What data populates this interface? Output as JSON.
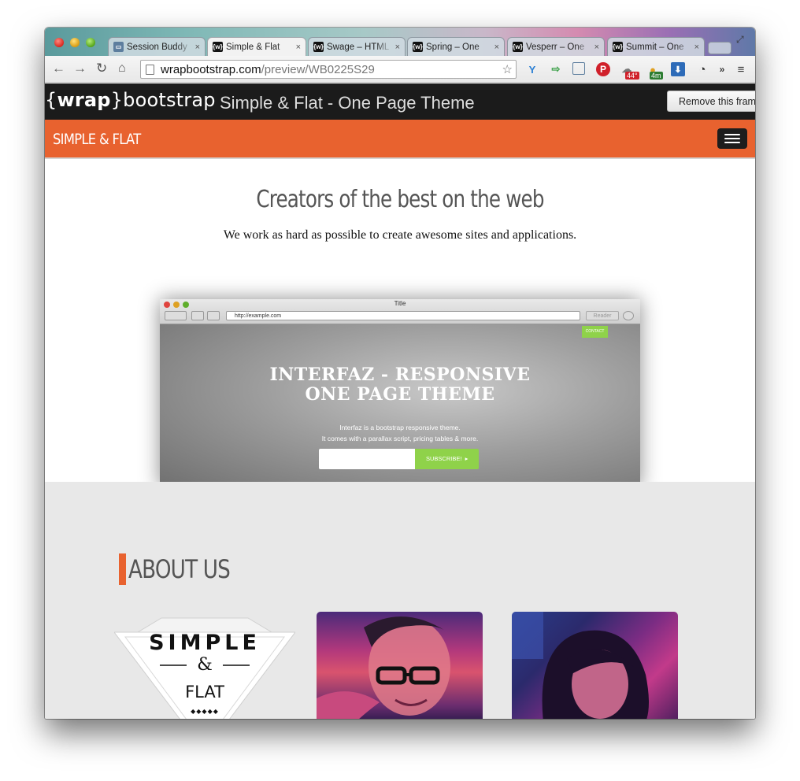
{
  "browser": {
    "tabs": [
      {
        "label": "Session Buddy",
        "icon": "session-buddy-icon",
        "active": false
      },
      {
        "label": "Simple & Flat",
        "icon": "wrap-icon",
        "active": true
      },
      {
        "label": "Swage – HTML",
        "icon": "wrap-icon",
        "active": false
      },
      {
        "label": "Spring – One",
        "icon": "wrap-icon",
        "active": false
      },
      {
        "label": "Vesperr – One",
        "icon": "wrap-icon",
        "active": false
      },
      {
        "label": "Summit – One",
        "icon": "wrap-icon",
        "active": false
      }
    ],
    "tab_close": "×",
    "favicon_text": "{w}",
    "url_host": "wrapbootstrap.com",
    "url_path": "/preview/WB0225S29",
    "badges": {
      "weather": "44°",
      "timer": "4m"
    }
  },
  "wrapbar": {
    "logo_open": "{",
    "logo_wrap": "wrap",
    "logo_close": "}",
    "logo_rest": "bootstrap",
    "title": "Simple & Flat - One Page Theme",
    "remove_frame": "Remove this frame"
  },
  "site": {
    "brand": "SIMPLE & FLAT",
    "accent": "#e8622f"
  },
  "hero": {
    "title": "Creators of the best on the web",
    "subtitle": "We work as hard as possible to create awesome sites and applications."
  },
  "mock": {
    "window_title": "Title",
    "url": "http://example.com",
    "reader": "Reader",
    "contact": "CONTACT",
    "headline_1": "INTERFAZ - RESPONSIVE",
    "headline_2": "ONE PAGE THEME",
    "text_1": "Interfaz is a bootstrap responsive theme.",
    "text_2": "It comes with a parallax script, pricing tables & more.",
    "subscribe": "SUBSCRIBE!"
  },
  "about": {
    "title": "ABOUT US",
    "logo_simple": "SIMPLE",
    "logo_amp": "&",
    "logo_flat": "FLAT",
    "logo_dots": "◆◆◆◆◆"
  }
}
